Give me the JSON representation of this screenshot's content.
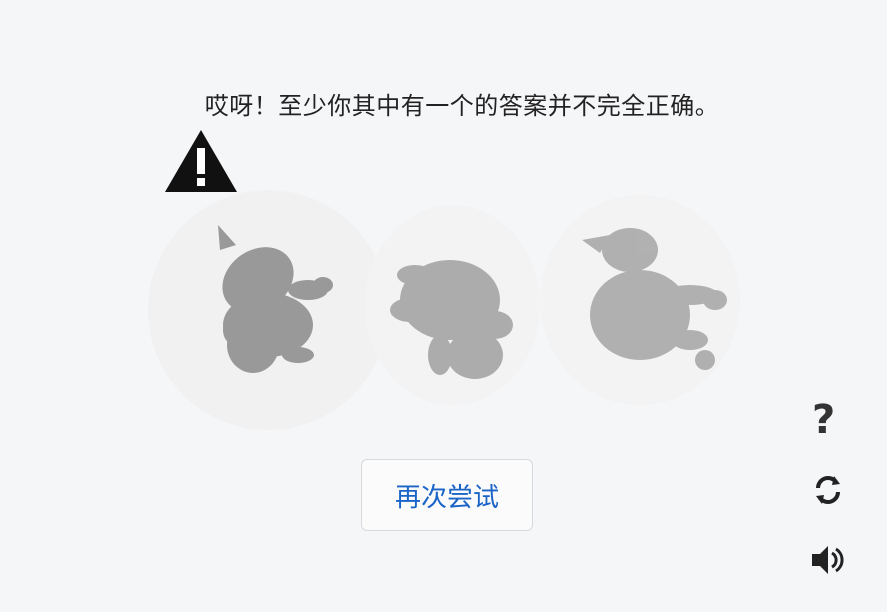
{
  "message": "哎呀！至少你其中有一个的答案并不完全正确。",
  "retry_label": "再次尝试",
  "icons": {
    "warning": "warning-icon",
    "help": "question-icon",
    "refresh": "refresh-icon",
    "audio": "audio-icon"
  },
  "help_glyph": "?"
}
